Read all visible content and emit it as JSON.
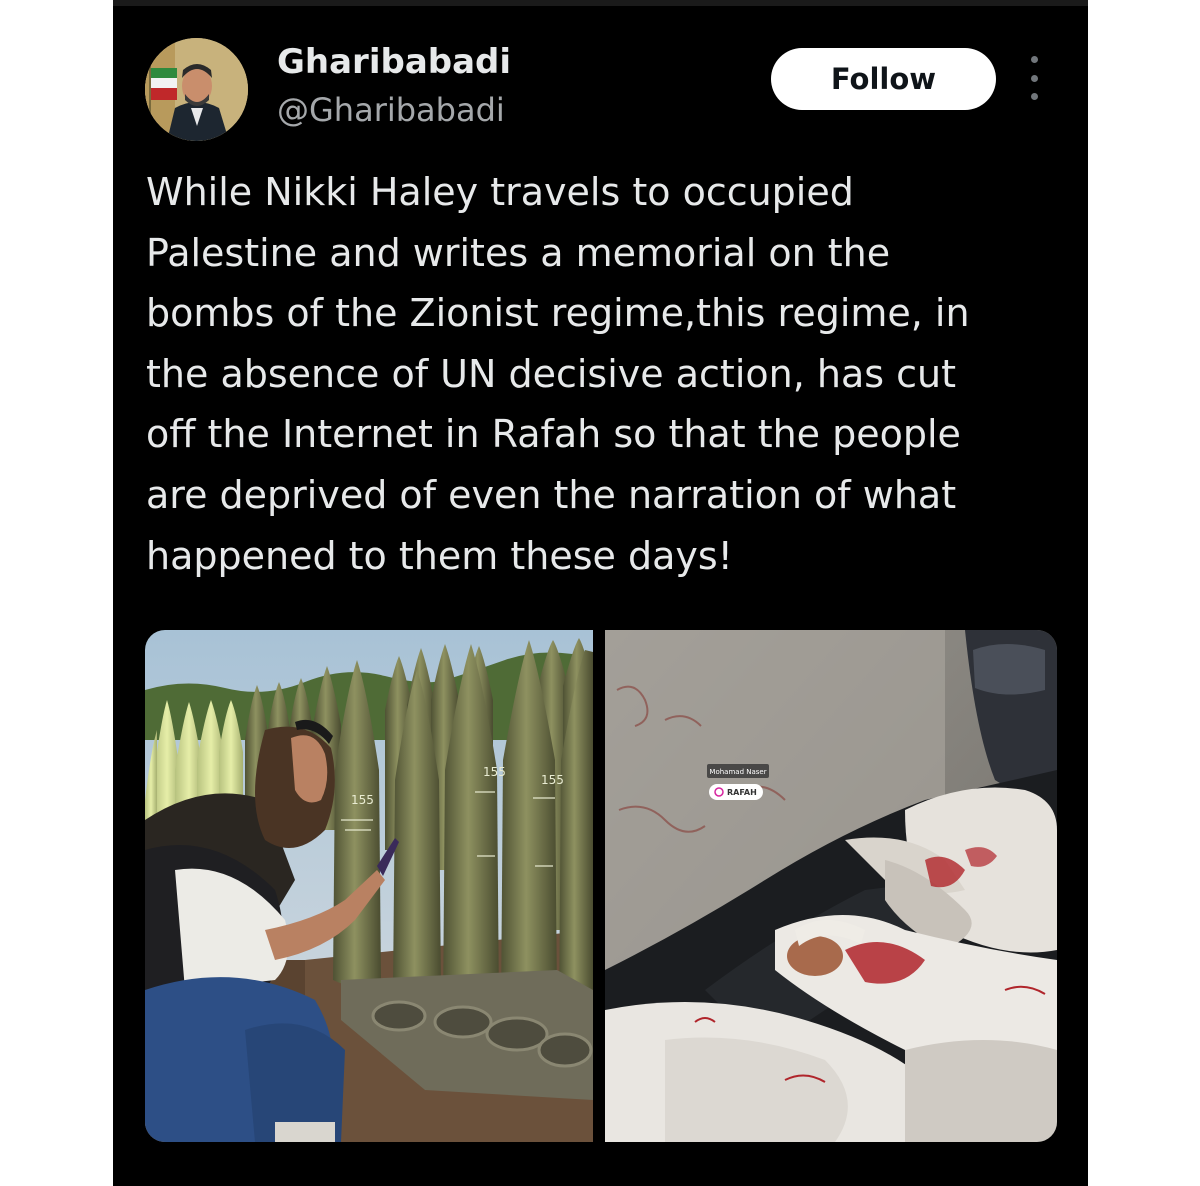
{
  "tweet": {
    "author": {
      "display_name": "Gharibabadi",
      "handle": "@Gharibabadi"
    },
    "follow_label": "Follow",
    "more_icon": "more-vertical-icon",
    "text": "While Nikki Haley travels to occupied\nPalestine and writes a memorial on the\nbombs of the Zionist regime,this regime, in\nthe absence of UN decisive action, has cut\noff the Internet in Rafah so that the people\nare deprived of even the narration of what\nhappened to them these days!"
  },
  "media": {
    "left_photo": {
      "shell_markings": [
        "155",
        "155",
        "155"
      ]
    },
    "right_photo": {
      "sticker_user": "Mohamad Naser",
      "sticker_location": "RAFAH"
    }
  },
  "colors": {
    "background": "#000000",
    "text_primary": "#e7e9ea",
    "text_secondary": "#a5a8ab",
    "follow_bg": "#ffffff"
  }
}
